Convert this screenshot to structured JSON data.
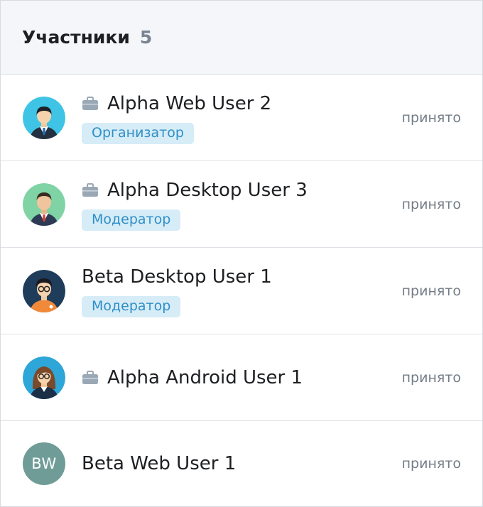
{
  "header": {
    "title": "Участники",
    "count": "5"
  },
  "participants": [
    {
      "name": "Alpha Web User 2",
      "role": "Организатор",
      "status": "принято",
      "has_case": true,
      "avatar": "man-suit-blue-bg-avatar"
    },
    {
      "name": "Alpha Desktop User 3",
      "role": "Модератор",
      "status": "принято",
      "has_case": true,
      "avatar": "man-red-tie-green-bg-avatar"
    },
    {
      "name": "Beta Desktop User 1",
      "role": "Модератор",
      "status": "принято",
      "has_case": false,
      "avatar": "man-glasses-navy-bg-avatar"
    },
    {
      "name": "Alpha Android User 1",
      "role": "",
      "status": "принято",
      "has_case": true,
      "avatar": "woman-glasses-blue-bg-avatar"
    },
    {
      "name": "Beta Web User 1",
      "role": "",
      "status": "принято",
      "has_case": false,
      "avatar_initials": "BW"
    }
  ],
  "colors": {
    "badge_bg": "#d6ecf7",
    "badge_text": "#2f8fc7",
    "header_bg": "#f4f6f9",
    "initials_bg": "#6f9c97"
  }
}
